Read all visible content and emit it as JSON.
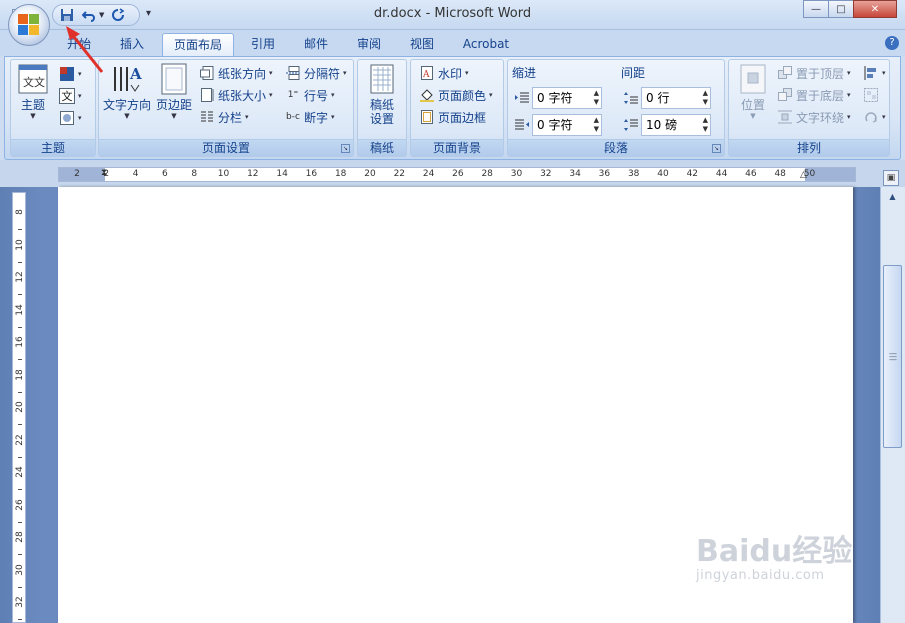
{
  "window": {
    "title": "dr.docx - Microsoft Word",
    "minimize_glyph": "—",
    "maximize_glyph": "□",
    "close_glyph": "✕"
  },
  "qat": {
    "save_icon": "save-icon",
    "undo_icon": "undo-icon",
    "redo_icon": "redo-icon",
    "customize_glyph": "▾"
  },
  "tabs": [
    {
      "label": "开始"
    },
    {
      "label": "插入"
    },
    {
      "label": "页面布局",
      "active": true
    },
    {
      "label": "引用"
    },
    {
      "label": "邮件"
    },
    {
      "label": "审阅"
    },
    {
      "label": "视图"
    },
    {
      "label": "Acrobat"
    }
  ],
  "help_glyph": "?",
  "groups": {
    "themes": {
      "label": "主题",
      "theme_button": "主题",
      "theme_icon_text": "文文"
    },
    "page_setup": {
      "label": "页面设置",
      "text_direction": "文字方向",
      "margins": "页边距",
      "orientation": "纸张方向",
      "size": "纸张大小",
      "columns": "分栏",
      "breaks": "分隔符",
      "line_numbers": "行号",
      "hyphenation": "断字"
    },
    "manuscript": {
      "label": "稿纸",
      "settings_line1": "稿纸",
      "settings_line2": "设置"
    },
    "page_background": {
      "label": "页面背景",
      "watermark": "水印",
      "page_color": "页面颜色",
      "page_borders": "页面边框"
    },
    "paragraph": {
      "label": "段落",
      "indent_heading": "缩进",
      "spacing_heading": "间距",
      "indent_left": "0 字符",
      "indent_right": "0 字符",
      "spacing_before": "0 行",
      "spacing_after": "10 磅"
    },
    "arrange": {
      "label": "排列",
      "position": "位置",
      "bring_front": "置于顶层",
      "send_back": "置于底层",
      "text_wrap": "文字环绕"
    }
  },
  "ruler": {
    "corner_glyph": "L",
    "h_ticks": [
      "2",
      "2",
      "4",
      "6",
      "8",
      "10",
      "12",
      "14",
      "16",
      "18",
      "20",
      "22",
      "24",
      "26",
      "28",
      "30",
      "32",
      "34",
      "36",
      "38",
      "40",
      "42",
      "44",
      "46",
      "48",
      "50"
    ],
    "v_ticks": [
      "8",
      "10",
      "12",
      "14",
      "16",
      "18",
      "20",
      "22",
      "24",
      "26",
      "28",
      "30",
      "32"
    ]
  },
  "watermark": {
    "brand": "Baidu经验",
    "url": "jingyan.baidu.com"
  },
  "colors": {
    "ribbon_text": "#15428b",
    "annotation_arrow": "#e0302a",
    "document_background": "#6b8ac0"
  }
}
